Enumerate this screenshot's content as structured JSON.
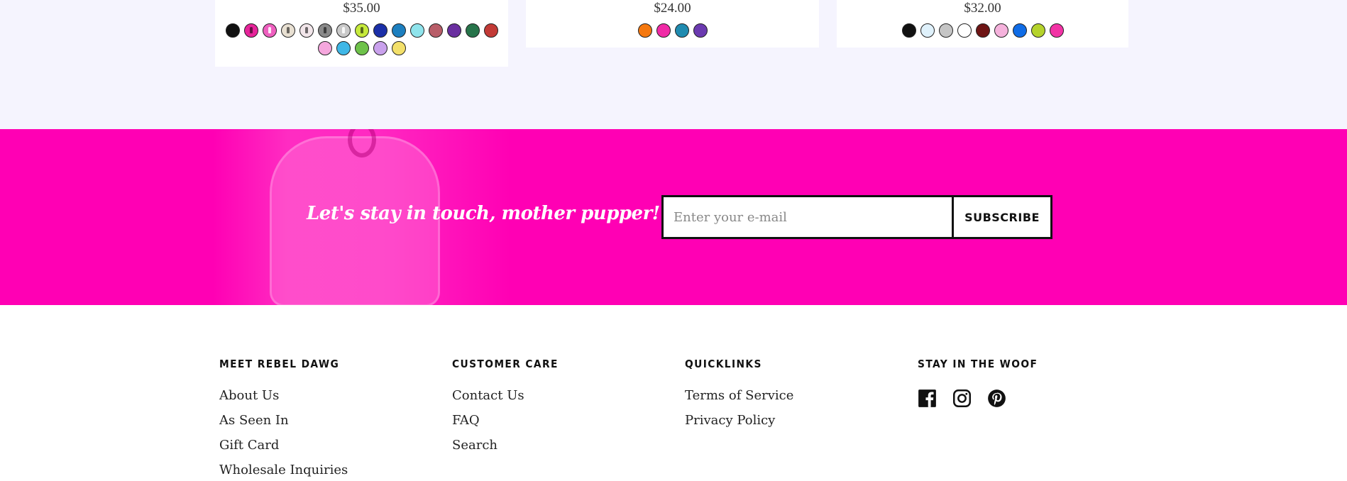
{
  "products": [
    {
      "price": "$35.00",
      "swatches": [
        {
          "color": "#111111",
          "tag": false
        },
        {
          "color": "#e6249a",
          "tag": true,
          "tag_dark": true
        },
        {
          "color": "#ee5fbf",
          "tag": true
        },
        {
          "color": "#e8e0d2",
          "tag": true,
          "tag_dark": true
        },
        {
          "color": "#f2e6ea",
          "tag": true,
          "tag_dark": true
        },
        {
          "color": "#8a8a8a",
          "tag": true,
          "tag_dark": true
        },
        {
          "color": "#c9c9c9",
          "tag": true
        },
        {
          "color": "#c6ea3c",
          "tag": true,
          "tag_dark": true
        },
        {
          "color": "#1b2fa8",
          "tag": false
        },
        {
          "color": "#1d7fbf",
          "tag": false
        },
        {
          "color": "#8fe4ec",
          "tag": false
        },
        {
          "color": "#b85d68",
          "tag": false
        },
        {
          "color": "#6a2fa0",
          "tag": false
        },
        {
          "color": "#27744a",
          "tag": false
        },
        {
          "color": "#c23a36",
          "tag": false
        },
        {
          "color": "#f5a7dd",
          "tag": false
        },
        {
          "color": "#3fb7e6",
          "tag": false
        },
        {
          "color": "#6ec24a",
          "tag": false
        },
        {
          "color": "#c9a1ec",
          "tag": false
        },
        {
          "color": "#f3e06a",
          "tag": false
        }
      ]
    },
    {
      "price": "$24.00",
      "swatches": [
        {
          "color": "#f5780f",
          "tag": false
        },
        {
          "color": "#f02aa6",
          "tag": false
        },
        {
          "color": "#1f8bb0",
          "tag": false
        },
        {
          "color": "#6b3ab0",
          "tag": false
        }
      ]
    },
    {
      "price": "$32.00",
      "swatches": [
        {
          "color": "#111111",
          "tag": false
        },
        {
          "color": "#dff1fb",
          "tag": false
        },
        {
          "color": "#c5c5c5",
          "tag": false
        },
        {
          "color": "#ffffff",
          "tag": false
        },
        {
          "color": "#6e1414",
          "tag": false
        },
        {
          "color": "#f5b2dc",
          "tag": false
        },
        {
          "color": "#0f6ce6",
          "tag": false
        },
        {
          "color": "#b5d32c",
          "tag": false
        },
        {
          "color": "#f233a5",
          "tag": false
        }
      ]
    }
  ],
  "newsletter": {
    "title": "Let's stay in touch, mother pupper!",
    "input_placeholder": "Enter your e-mail",
    "button_label": "SUBSCRIBE",
    "bg_color": "#ff00b4"
  },
  "footer": {
    "columns": [
      {
        "heading": "MEET REBEL DAWG",
        "links": [
          "About Us",
          "As Seen In",
          "Gift Card",
          "Wholesale Inquiries"
        ]
      },
      {
        "heading": "CUSTOMER CARE",
        "links": [
          "Contact Us",
          "FAQ",
          "Search"
        ]
      },
      {
        "heading": "QUICKLINKS",
        "links": [
          "Terms of Service",
          "Privacy Policy"
        ]
      },
      {
        "heading": "STAY IN THE WOOF",
        "links": []
      }
    ],
    "socials": [
      "facebook-icon",
      "instagram-icon",
      "pinterest-icon"
    ]
  }
}
